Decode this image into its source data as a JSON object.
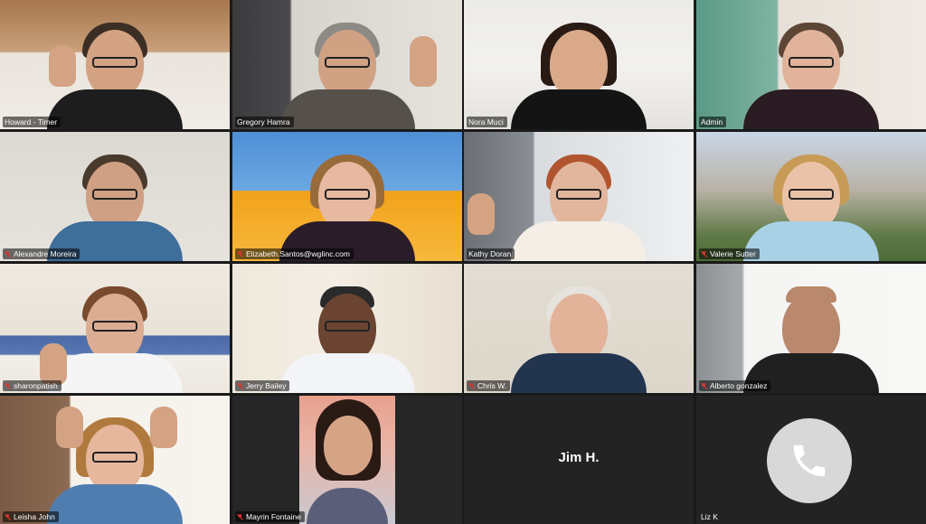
{
  "app": {
    "type": "video-conference-gallery-view"
  },
  "colors": {
    "active_border": "#e8e13a",
    "label_bg": "rgba(0,0,0,0.55)",
    "muted_mic": "#e0342f",
    "tile_bg": "#232323"
  },
  "participants": [
    {
      "name": "Howard - Timer",
      "muted": false
    },
    {
      "name": "Gregory Hamra",
      "muted": false,
      "active_speaker": true
    },
    {
      "name": "Nora Muci",
      "muted": false
    },
    {
      "name": "Admin",
      "muted": false
    },
    {
      "name": "Alexandre Moreira",
      "muted": true
    },
    {
      "name": "Elizabeth.Santos@wgIinc.com",
      "muted": true
    },
    {
      "name": "Kathy Doran",
      "muted": false
    },
    {
      "name": "Valerie Sutter",
      "muted": true
    },
    {
      "name": "sharonpatish",
      "muted": true
    },
    {
      "name": "Jerry Bailey",
      "muted": true
    },
    {
      "name": "Chris W.",
      "muted": true
    },
    {
      "name": "Alberto gonzalez",
      "muted": true
    },
    {
      "name": "Leisha John",
      "muted": true
    },
    {
      "name": "Mayrin Fontaine",
      "muted": true
    },
    {
      "name": "",
      "muted": false,
      "center_name": "Jim H.",
      "video_off": true
    },
    {
      "name": "Liz K",
      "muted": false,
      "phone_only": true,
      "icon": "phone-icon"
    }
  ]
}
